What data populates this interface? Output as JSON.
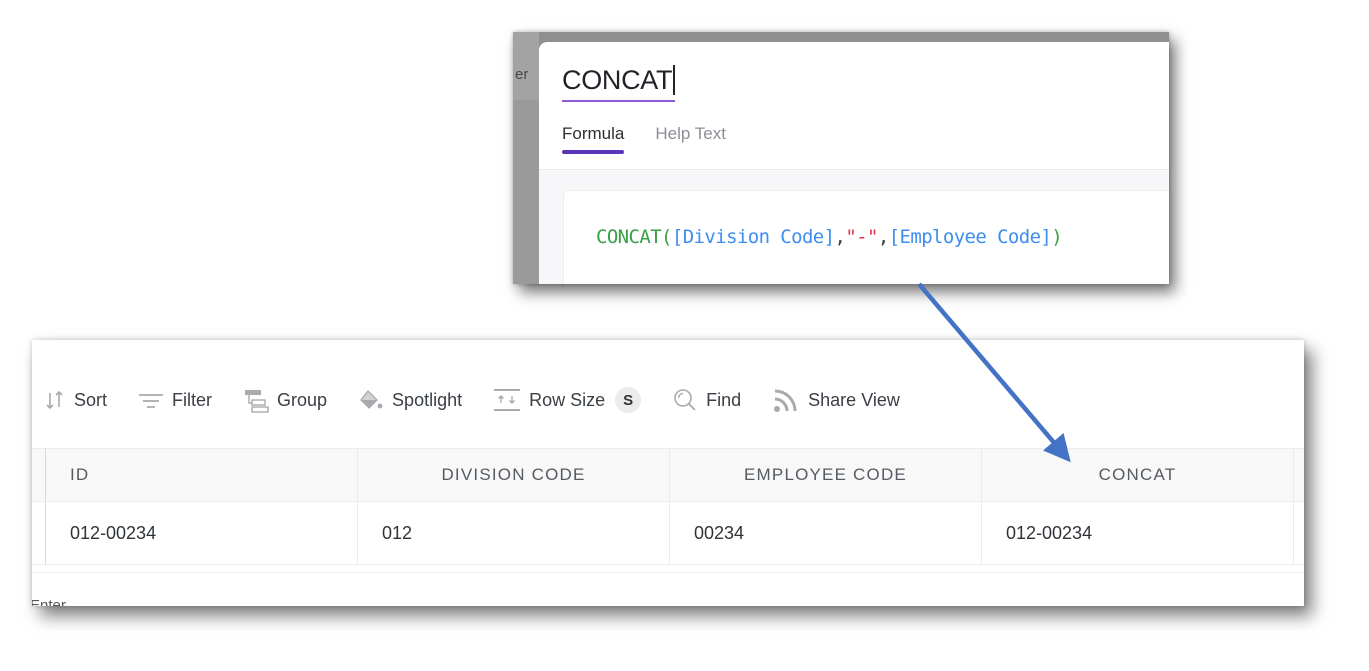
{
  "formula_panel": {
    "background_partial_text": "er",
    "field_name": "CONCAT",
    "tabs": [
      {
        "label": "Formula",
        "active": true
      },
      {
        "label": "Help Text",
        "active": false
      }
    ],
    "formula": {
      "tokens": [
        {
          "type": "fn",
          "text": "CONCAT("
        },
        {
          "type": "ref",
          "text": "[Division Code]"
        },
        {
          "type": "punct",
          "text": ","
        },
        {
          "type": "str",
          "text": "\"-\""
        },
        {
          "type": "punct",
          "text": ","
        },
        {
          "type": "ref",
          "text": "[Employee Code]"
        },
        {
          "type": "fn",
          "text": ")"
        }
      ]
    },
    "colors": {
      "accent_underline": "#5a33b8",
      "input_underline": "#8a5cd6",
      "function": "#3aa046",
      "field_ref": "#3d8ef0",
      "string": "#e0334f"
    }
  },
  "grid_panel": {
    "toolbar": {
      "sort": {
        "label": "Sort",
        "icon": "sort-icon"
      },
      "filter": {
        "label": "Filter",
        "icon": "filter-icon"
      },
      "group": {
        "label": "Group",
        "icon": "group-icon"
      },
      "spotlight": {
        "label": "Spotlight",
        "icon": "paint-bucket-icon"
      },
      "row_size": {
        "label": "Row Size",
        "icon": "row-height-icon",
        "value": "S"
      },
      "find": {
        "label": "Find",
        "icon": "search-icon"
      },
      "share_view": {
        "label": "Share View",
        "icon": "rss-icon"
      }
    },
    "columns": [
      "ID",
      "DIVISION CODE",
      "EMPLOYEE CODE",
      "CONCAT"
    ],
    "rows": [
      [
        "012-00234",
        "012",
        "00234",
        "012-00234"
      ]
    ],
    "footer_partial_text": "Enter"
  },
  "annotation": {
    "arrow_color": "#4472c4",
    "arrow_meaning": "formula-to-concat-column"
  }
}
